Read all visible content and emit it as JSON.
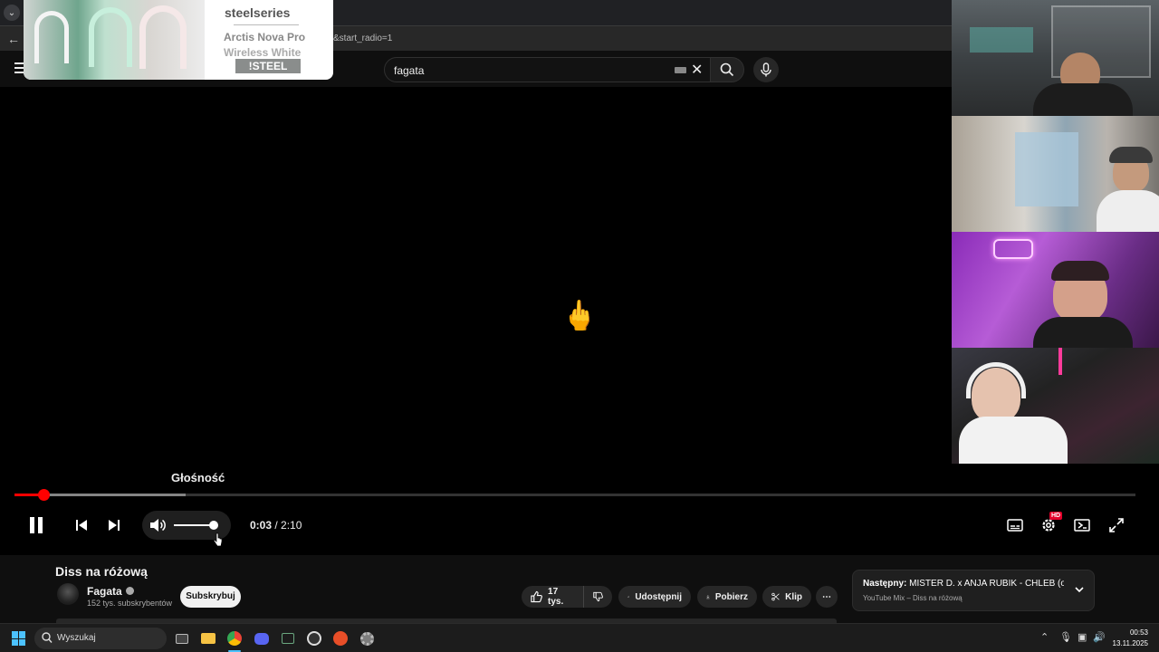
{
  "browser": {
    "url_fragment": "&start_radio=1"
  },
  "youtube": {
    "search": {
      "value": "fagata"
    }
  },
  "ad": {
    "brand": "steelseries",
    "product_line1": "Arctis Nova Pro",
    "product_line2": "Wireless White",
    "code": "!STEEL"
  },
  "player": {
    "center_emoji": "🖕",
    "volume_tooltip": "Głośność",
    "current_time": "0:03",
    "duration": "2:10",
    "time_separator": " / ",
    "progress_fraction": 0.026,
    "buffered_fraction": 0.153,
    "volume_fraction": 1.0,
    "quality_badge": "HD",
    "progress_color": "#ff0000"
  },
  "video": {
    "title": "Diss na różową",
    "channel": "Fagata",
    "subscribers": "152 tys. subskrybentów",
    "subscribe_label": "Subskrybuj",
    "likes": "17 tys.",
    "share_label": "Udostępnij",
    "download_label": "Pobierz",
    "clip_label": "Klip",
    "more_label": "⋯"
  },
  "up_next": {
    "prefix": "Następny:",
    "title": "MISTER D. x ANJA RUBIK - CHLEB (offici...",
    "subtitle": "YouTube Mix – Diss na różową"
  },
  "taskbar": {
    "search_placeholder": "Wyszukaj",
    "time": "00:53",
    "date": "13.11.2025",
    "accent": "#4cc2ff"
  }
}
